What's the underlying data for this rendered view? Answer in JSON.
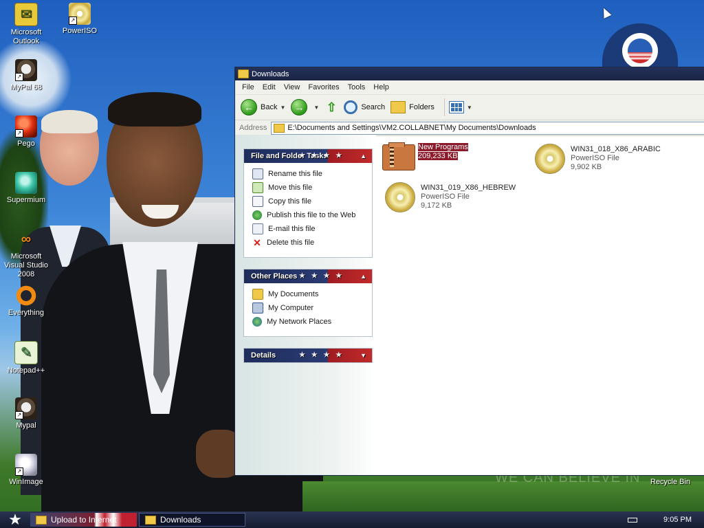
{
  "desktop": {
    "icons": [
      {
        "label": "Microsoft Outlook",
        "icon": "outlook-icon"
      },
      {
        "label": "PowerISO",
        "icon": "poweriso-icon"
      },
      {
        "label": "MyPal 68",
        "icon": "mypal-icon"
      },
      {
        "label": "Pego",
        "icon": "pego-icon"
      },
      {
        "label": "Supermium",
        "icon": "supermium-icon"
      },
      {
        "label": "Microsoft Visual Studio 2008",
        "icon": "visual-studio-icon"
      },
      {
        "label": "Everything",
        "icon": "everything-icon"
      },
      {
        "label": "Notepad++",
        "icon": "notepad-plus-plus-icon"
      },
      {
        "label": "Mypal",
        "icon": "mypal-icon"
      },
      {
        "label": "WinImage",
        "icon": "winimage-icon"
      }
    ],
    "recycle_bin": "Recycle Bin",
    "slogan": "WE CAN BELIEVE IN"
  },
  "window": {
    "title": "Downloads",
    "menu": [
      "File",
      "Edit",
      "View",
      "Favorites",
      "Tools",
      "Help"
    ],
    "toolbar": {
      "back": "Back",
      "search": "Search",
      "folders": "Folders"
    },
    "address": {
      "label": "Address",
      "value": "E:\\Documents and Settings\\VM2.COLLABNET\\My Documents\\Downloads"
    },
    "panels": {
      "file_tasks": {
        "title": "File and Folder Tasks",
        "items": [
          {
            "label": "Rename this file",
            "icon": "rename-icon"
          },
          {
            "label": "Move this file",
            "icon": "move-icon"
          },
          {
            "label": "Copy this file",
            "icon": "copy-icon"
          },
          {
            "label": "Publish this file to the Web",
            "icon": "publish-web-icon"
          },
          {
            "label": "E-mail this file",
            "icon": "email-icon"
          },
          {
            "label": "Delete this file",
            "icon": "delete-icon"
          }
        ]
      },
      "other_places": {
        "title": "Other Places",
        "items": [
          {
            "label": "My Documents",
            "icon": "my-documents-icon"
          },
          {
            "label": "My Computer",
            "icon": "my-computer-icon"
          },
          {
            "label": "My Network Places",
            "icon": "network-places-icon"
          }
        ]
      },
      "details": {
        "title": "Details"
      }
    },
    "files": [
      {
        "name": "New Programs",
        "type": "",
        "size": "209,233 KB",
        "icon": "zip-folder-icon",
        "selected": true
      },
      {
        "name": "WIN31_018_X86_ARABIC",
        "type": "PowerISO File",
        "size": "9,902 KB",
        "icon": "disc-image-icon",
        "selected": false
      },
      {
        "name": "WIN31_019_X86_HEBREW",
        "type": "PowerISO File",
        "size": "9,172 KB",
        "icon": "disc-image-icon",
        "selected": false
      }
    ]
  },
  "taskbar": {
    "items": [
      "Upload to Internet",
      "Downloads"
    ],
    "clock": "9:05 PM"
  },
  "colors": {
    "selection": "#8b1a2a",
    "panel_header_blue": "#1f2d5c",
    "panel_header_red": "#c02a2a",
    "taskbar": "#151b30"
  }
}
